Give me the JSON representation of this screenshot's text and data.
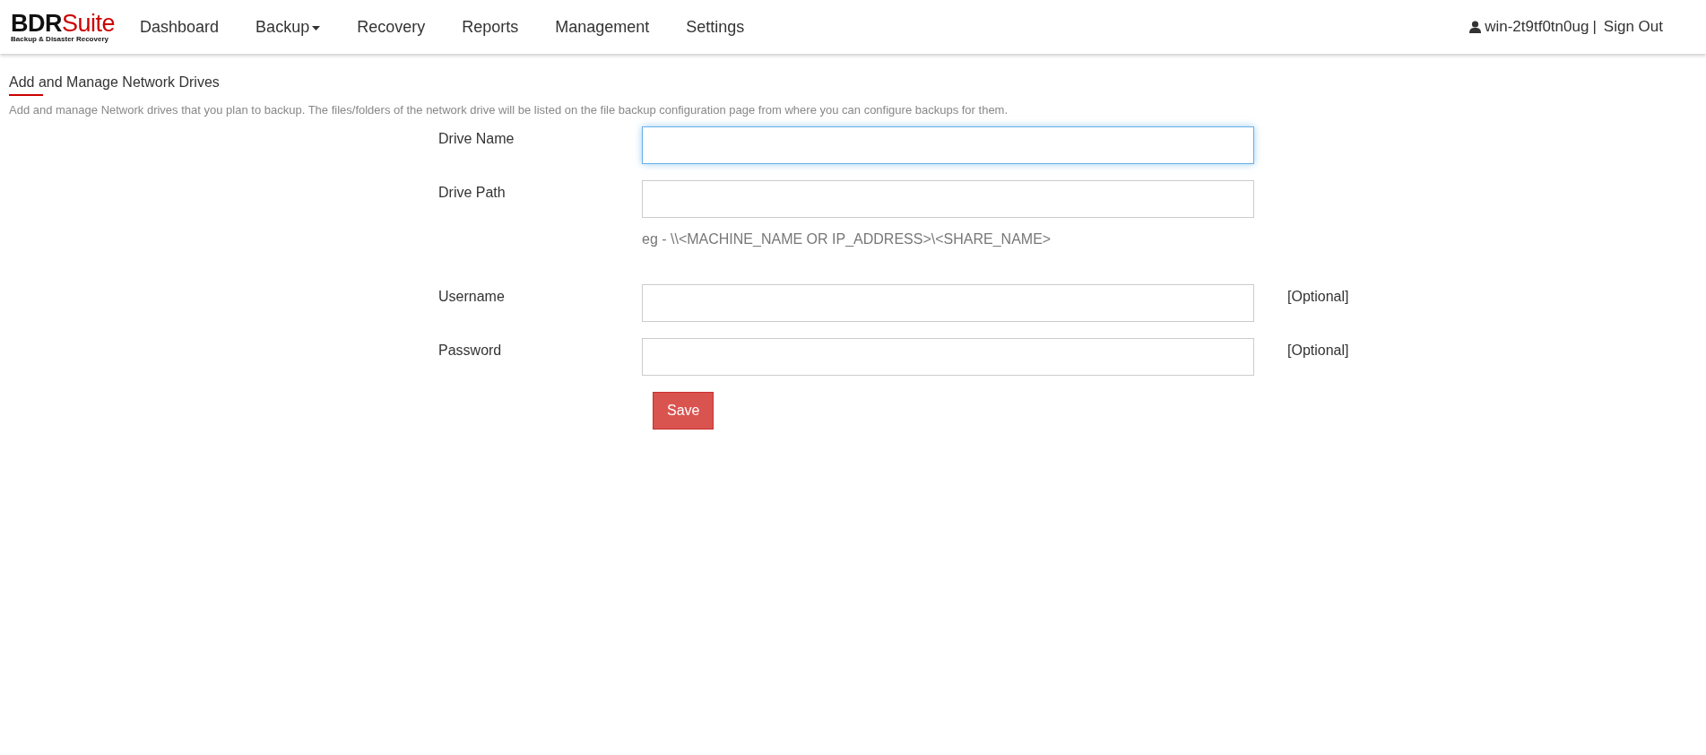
{
  "logo": {
    "brand_main": "BDR",
    "brand_accent": "Suite",
    "tagline": "Backup & Disaster Recovery"
  },
  "nav": [
    {
      "label": "Dashboard",
      "dropdown": false
    },
    {
      "label": "Backup",
      "dropdown": true
    },
    {
      "label": "Recovery",
      "dropdown": false
    },
    {
      "label": "Reports",
      "dropdown": false
    },
    {
      "label": "Management",
      "dropdown": false
    },
    {
      "label": "Settings",
      "dropdown": false
    }
  ],
  "user": {
    "name": "win-2t9tf0tn0ug",
    "separator": "|",
    "sign_out": "Sign Out"
  },
  "page": {
    "title": "Add and Manage Network Drives",
    "description": "Add and manage Network drives that you plan to backup. The files/folders of the network drive will be listed on the file backup configuration page from where you can configure backups for them."
  },
  "form": {
    "fields": [
      {
        "label": "Drive Name",
        "focused": true
      },
      {
        "label": "Drive Path",
        "focused": false,
        "hint": "eg - \\\\<MACHINE_NAME OR IP_ADDRESS>\\<SHARE_NAME>"
      },
      {
        "label": "Username",
        "focused": false,
        "note": "[Optional]"
      },
      {
        "label": "Password",
        "focused": false,
        "note": "[Optional]"
      }
    ],
    "save_button": "Save"
  }
}
